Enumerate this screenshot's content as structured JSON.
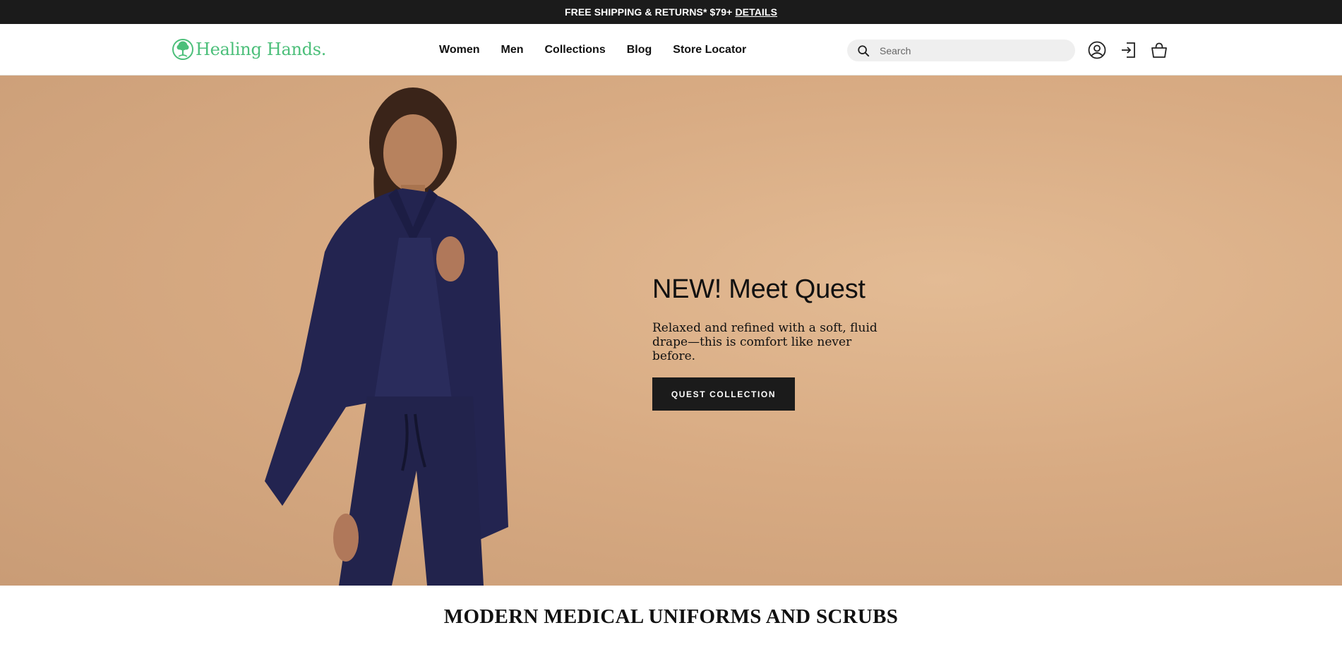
{
  "announcement": {
    "text": "FREE SHIPPING & RETURNS* $79+",
    "link": "DETAILS"
  },
  "header": {
    "logo_text": "Healing Hands",
    "logo_dot": ".",
    "nav": [
      "Women",
      "Men",
      "Collections",
      "Blog",
      "Store Locator"
    ],
    "search_placeholder": "Search",
    "icons": [
      "search-icon",
      "account-icon",
      "login-icon",
      "cart-icon"
    ]
  },
  "hero": {
    "title": "NEW! Meet Quest",
    "subtitle": "Relaxed and refined with a soft, fluid drape—this is comfort like never before.",
    "button": "QUEST COLLECTION"
  },
  "section": {
    "heading": "MODERN MEDICAL UNIFORMS AND SCRUBS"
  },
  "colors": {
    "brand_green": "#4cbf7a",
    "announcement_bg": "#1b1b1b",
    "hero_bg": "#d8ab83",
    "scrub_navy": "#232450"
  }
}
